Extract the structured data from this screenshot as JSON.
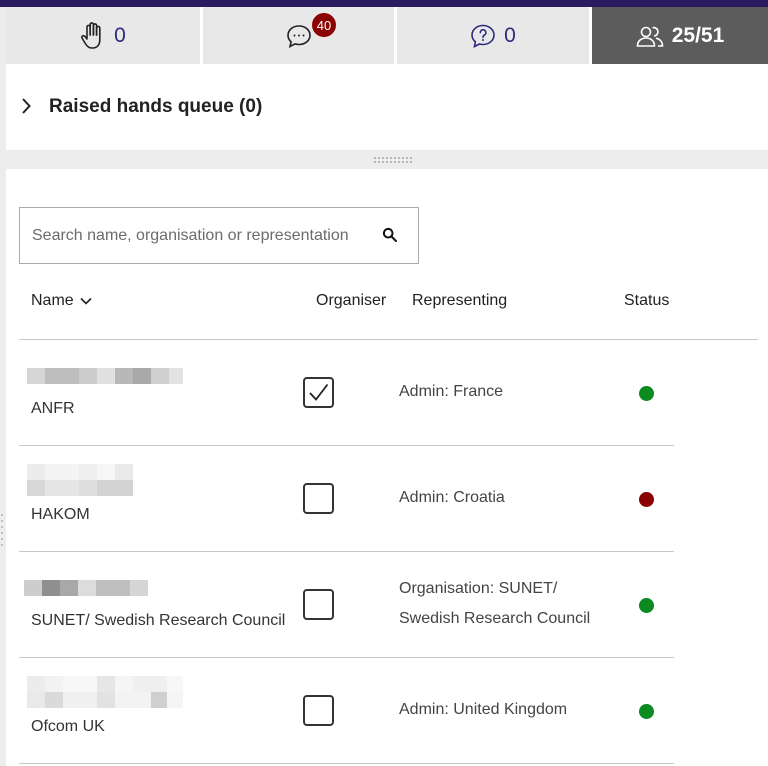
{
  "tabs": {
    "hands": {
      "icon": "hand-icon",
      "count": "0"
    },
    "chat": {
      "icon": "chat-bubble-icon",
      "badge": "40"
    },
    "questions": {
      "icon": "question-bubble-icon",
      "count": "0"
    },
    "participants": {
      "icon": "people-icon",
      "count": "25/51"
    }
  },
  "raised_hands": {
    "title": "Raised hands queue (0)"
  },
  "search": {
    "placeholder": "Search name, organisation or representation",
    "value": ""
  },
  "table": {
    "headers": {
      "name": "Name",
      "organiser": "Organiser",
      "representing": "Representing",
      "status": "Status"
    },
    "rows": [
      {
        "organisation": "ANFR",
        "organiser": true,
        "representing_1": "Admin: France",
        "representing_2": "",
        "status": "online"
      },
      {
        "organisation": "HAKOM",
        "organiser": false,
        "representing_1": "Admin: Croatia",
        "representing_2": "",
        "status": "offline"
      },
      {
        "organisation": "SUNET/ Swedish Research Council",
        "organiser": false,
        "representing_1": "Organisation: SUNET/",
        "representing_2": "Swedish Research Council",
        "status": "online"
      },
      {
        "organisation": "Ofcom UK",
        "organiser": false,
        "representing_1": "Admin: United Kingdom",
        "representing_2": "",
        "status": "online"
      }
    ]
  },
  "colors": {
    "top_bar": "#2a1a5e",
    "tab_text": "#2d2a7e",
    "active_tab": "#5c5c5c",
    "badge": "#8b0000",
    "status_online": "#0a8a1f",
    "status_offline": "#8b0000"
  }
}
